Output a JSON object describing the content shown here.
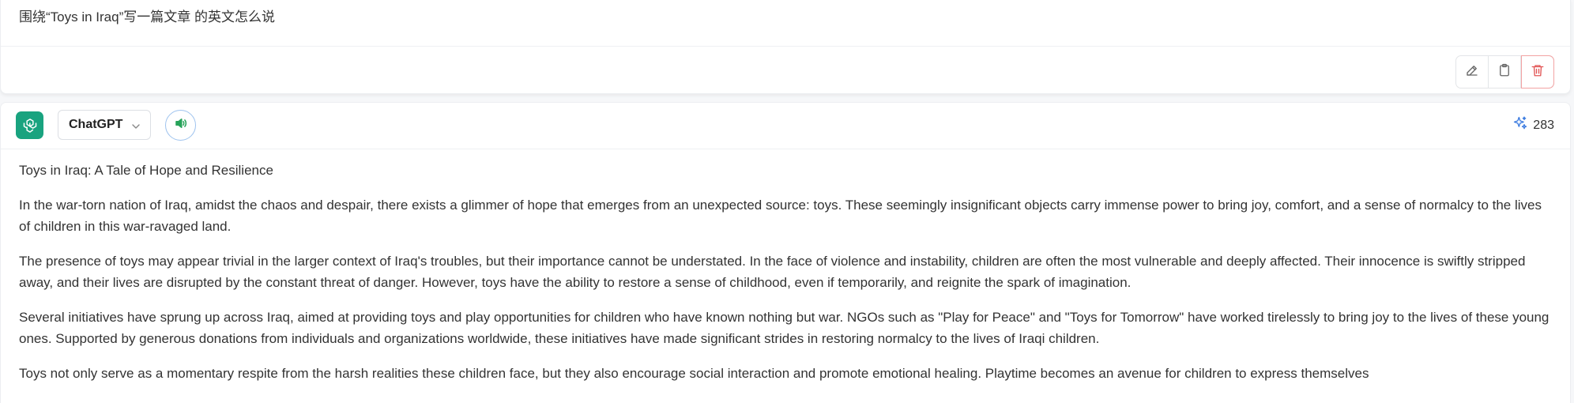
{
  "user_message": {
    "text": "围绕“Toys in Iraq”写一篇文章 的英文怎么说",
    "actions": [
      {
        "name": "edit-button",
        "icon": "pencil-icon"
      },
      {
        "name": "copy-button",
        "icon": "clipboard-icon"
      },
      {
        "name": "delete-button",
        "icon": "trash-icon"
      }
    ]
  },
  "assistant": {
    "avatar_icon": "openai-logo-icon",
    "model": "ChatGPT",
    "speaker_icon": "speaker-icon",
    "token_icon": "sparkles-icon",
    "token_count": "283",
    "paragraphs": [
      "Toys in Iraq: A Tale of Hope and Resilience",
      "In the war-torn nation of Iraq, amidst the chaos and despair, there exists a glimmer of hope that emerges from an unexpected source: toys. These seemingly insignificant objects carry immense power to bring joy, comfort, and a sense of normalcy to the lives of children in this war-ravaged land.",
      "The presence of toys may appear trivial in the larger context of Iraq's troubles, but their importance cannot be understated. In the face of violence and instability, children are often the most vulnerable and deeply affected. Their innocence is swiftly stripped away, and their lives are disrupted by the constant threat of danger. However, toys have the ability to restore a sense of childhood, even if temporarily, and reignite the spark of imagination.",
      "Several initiatives have sprung up across Iraq, aimed at providing toys and play opportunities for children who have known nothing but war. NGOs such as \"Play for Peace\" and \"Toys for Tomorrow\" have worked tirelessly to bring joy to the lives of these young ones. Supported by generous donations from individuals and organizations worldwide, these initiatives have made significant strides in restoring normalcy to the lives of Iraqi children.",
      "Toys not only serve as a momentary respite from the harsh realities these children face, but they also encourage social interaction and promote emotional healing. Playtime becomes an avenue for children to express themselves"
    ]
  },
  "colors": {
    "avatar_bg": "#19a37f",
    "danger": "#e25555",
    "accent_blue": "#3b7be0",
    "speaker_green": "#27a35a"
  }
}
